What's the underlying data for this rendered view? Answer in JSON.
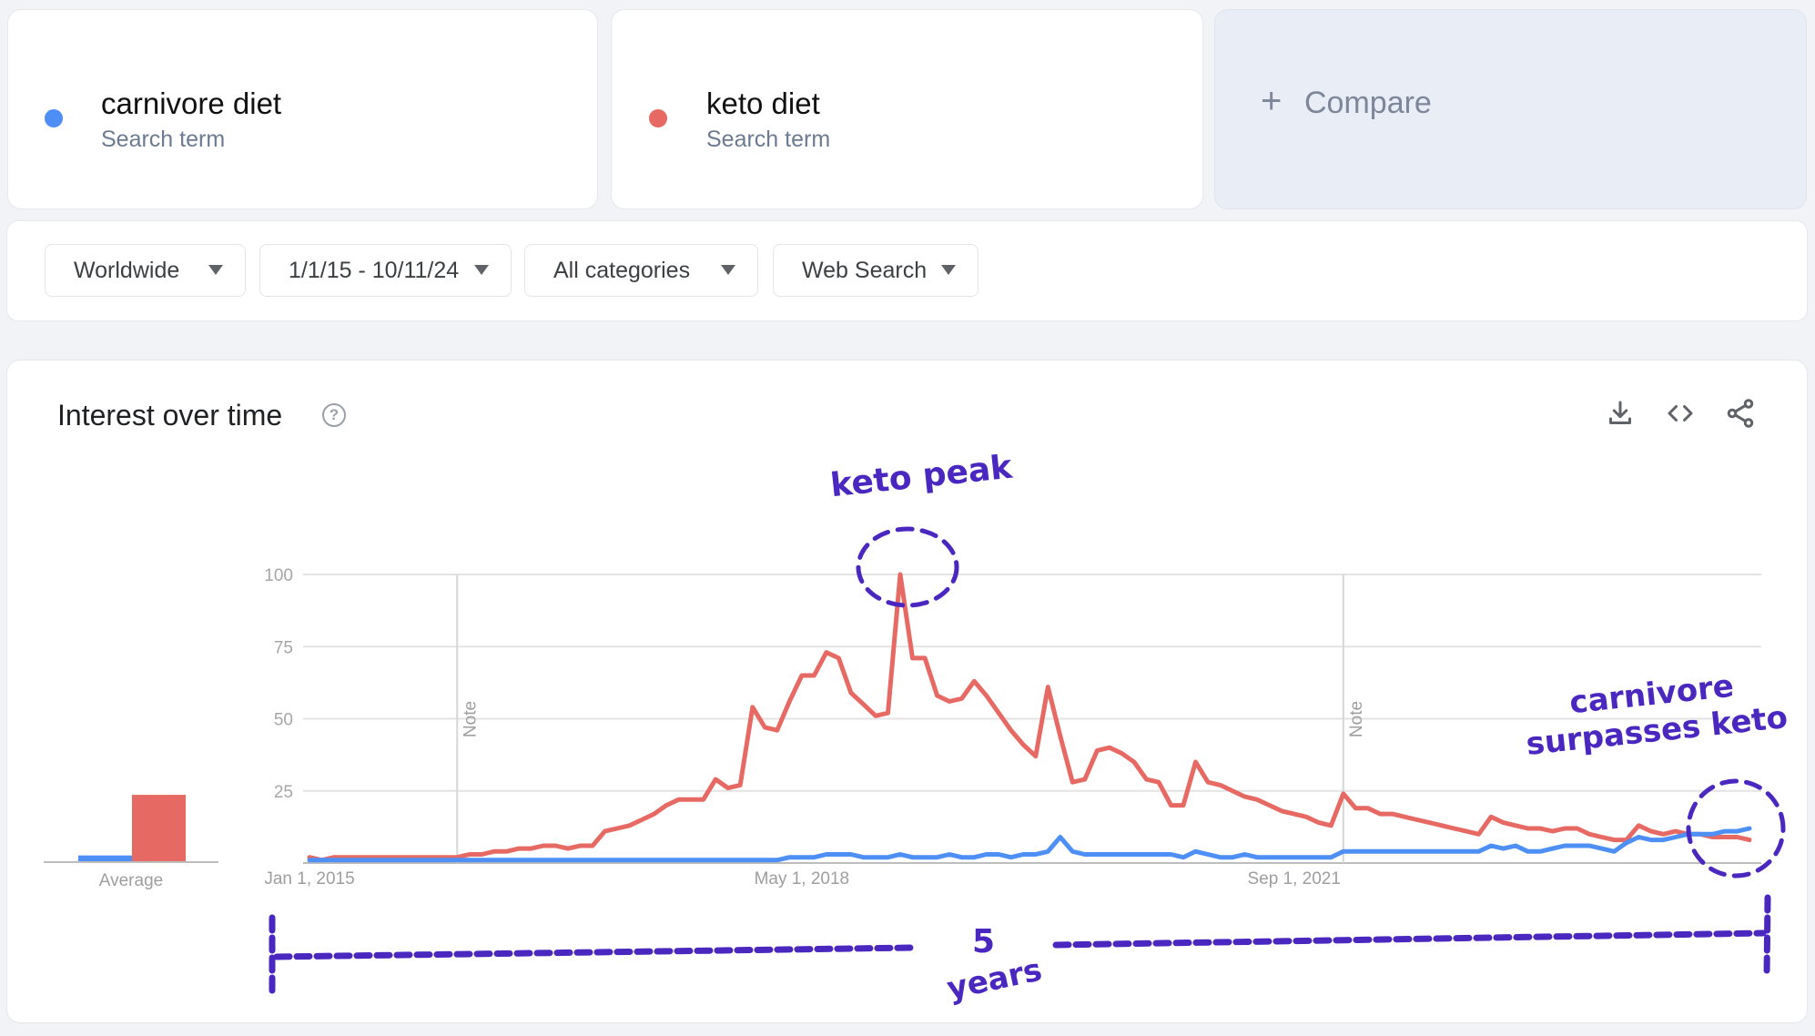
{
  "terms": [
    {
      "name": "carnivore diet",
      "subtitle": "Search term",
      "color": "#4e8ff5"
    },
    {
      "name": "keto diet",
      "subtitle": "Search term",
      "color": "#e66a63"
    }
  ],
  "compare": {
    "icon": "plus-icon",
    "label": "Compare"
  },
  "filters": [
    {
      "label": "Worldwide",
      "icon": "caret-down-icon"
    },
    {
      "label": "1/1/15 - 10/11/24",
      "icon": "caret-down-icon"
    },
    {
      "label": "All categories",
      "icon": "caret-down-icon"
    },
    {
      "label": "Web Search",
      "icon": "caret-down-icon"
    }
  ],
  "panel": {
    "title": "Interest over time",
    "help_icon": "?",
    "actions": [
      {
        "name": "download-icon",
        "label": "Download CSV"
      },
      {
        "name": "embed-icon",
        "label": "Embed"
      },
      {
        "name": "share-icon",
        "label": "Share"
      }
    ]
  },
  "annotations": {
    "color": "#4a28c0",
    "peak_label": "keto peak",
    "surpass_label_line1": "carnivore",
    "surpass_label_line2": "surpasses keto",
    "span_number": "5",
    "span_unit": "years"
  },
  "chart_data": {
    "type": "line",
    "title": "Interest over time",
    "xlabel": "",
    "ylabel": "",
    "ylim": [
      0,
      100
    ],
    "yticks": [
      "100",
      "75",
      "50",
      "25"
    ],
    "grid": true,
    "x_start": "2015-01",
    "x_end": "2024-10",
    "x_interval": "monthly",
    "xtick_labels": [
      {
        "label": "Jan 1, 2015",
        "month_index": 0
      },
      {
        "label": "May 1, 2018",
        "month_index": 40
      },
      {
        "label": "Sep 1, 2021",
        "month_index": 80
      }
    ],
    "notes": [
      {
        "label": "Note",
        "month_index": 12
      },
      {
        "label": "Note",
        "month_index": 84
      }
    ],
    "average": {
      "label": "Average",
      "values": [
        {
          "name": "carnivore diet",
          "value": 2
        },
        {
          "name": "keto diet",
          "value": 23
        }
      ]
    },
    "series": [
      {
        "name": "carnivore diet",
        "color": "#4e8ff5",
        "values": [
          1,
          1,
          1,
          1,
          1,
          1,
          1,
          1,
          1,
          1,
          1,
          1,
          1,
          1,
          1,
          1,
          1,
          1,
          1,
          1,
          1,
          1,
          1,
          1,
          1,
          1,
          1,
          1,
          1,
          1,
          1,
          1,
          1,
          1,
          1,
          1,
          1,
          1,
          1,
          2,
          2,
          2,
          3,
          3,
          3,
          2,
          2,
          2,
          3,
          2,
          2,
          2,
          3,
          2,
          2,
          3,
          3,
          2,
          3,
          3,
          4,
          9,
          4,
          3,
          3,
          3,
          3,
          3,
          3,
          3,
          3,
          2,
          4,
          3,
          2,
          2,
          3,
          2,
          2,
          2,
          2,
          2,
          2,
          2,
          4,
          4,
          4,
          4,
          4,
          4,
          4,
          4,
          4,
          4,
          4,
          4,
          6,
          5,
          6,
          4,
          4,
          5,
          6,
          6,
          6,
          5,
          4,
          7,
          9,
          8,
          8,
          9,
          10,
          10,
          10,
          11,
          11,
          12
        ]
      },
      {
        "name": "keto diet",
        "color": "#e66a63",
        "values": [
          2,
          1,
          2,
          2,
          2,
          2,
          2,
          2,
          2,
          2,
          2,
          2,
          2,
          3,
          3,
          4,
          4,
          5,
          5,
          6,
          6,
          5,
          6,
          6,
          11,
          12,
          13,
          15,
          17,
          20,
          22,
          22,
          22,
          29,
          26,
          27,
          54,
          47,
          46,
          56,
          65,
          65,
          73,
          71,
          59,
          55,
          51,
          52,
          100,
          71,
          71,
          58,
          56,
          57,
          63,
          58,
          52,
          46,
          41,
          37,
          61,
          44,
          28,
          29,
          39,
          40,
          38,
          35,
          29,
          28,
          20,
          20,
          35,
          28,
          27,
          25,
          23,
          22,
          20,
          18,
          17,
          16,
          14,
          13,
          24,
          19,
          19,
          17,
          17,
          16,
          15,
          14,
          13,
          12,
          11,
          10,
          16,
          14,
          13,
          12,
          12,
          11,
          12,
          12,
          10,
          9,
          8,
          8,
          13,
          11,
          10,
          11,
          10,
          10,
          9,
          9,
          9,
          8
        ]
      }
    ]
  }
}
